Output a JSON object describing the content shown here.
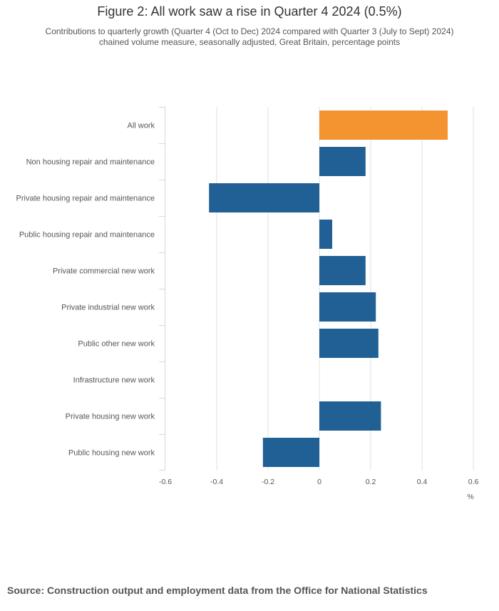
{
  "title": "Figure 2: All work saw a rise in Quarter 4 2024 (0.5%)",
  "subtitle_lines": [
    "Contributions to quarterly growth (Quarter 4 (Oct to Dec) 2024 compared with Quarter 3 (July to Sept) 2024)",
    "chained volume measure, seasonally adjusted, Great Britain, percentage points"
  ],
  "source": "Source: Construction output and employment data from the Office for National Statistics",
  "colors": {
    "highlight": "#f39431",
    "default": "#206095",
    "grid": "#e0e0e0",
    "axis": "#d0d8e4"
  },
  "chart_data": {
    "type": "bar",
    "orientation": "horizontal",
    "title": "Figure 2: All work saw a rise in Quarter 4 2024 (0.5%)",
    "xlabel": "%",
    "ylabel": "",
    "categories": [
      "All work",
      "Non housing repair and maintenance",
      "Private housing repair and maintenance",
      "Public housing repair and maintenance",
      "Private commercial new work",
      "Private industrial new work",
      "Public other new work",
      "Infrastructure new work",
      "Private housing new work",
      "Public housing new work"
    ],
    "values": [
      0.5,
      0.18,
      -0.43,
      0.05,
      0.18,
      0.22,
      0.23,
      0.0,
      0.24,
      -0.22
    ],
    "highlighted_categories": [
      "All work"
    ],
    "xlim": [
      -0.6,
      0.6
    ],
    "xticks": [
      -0.6,
      -0.4,
      -0.2,
      0,
      0.2,
      0.4,
      0.6
    ],
    "xtick_labels": [
      "-0.6",
      "-0.4",
      "-0.2",
      "0",
      "0.2",
      "0.4",
      "0.6"
    ],
    "grid": true,
    "legend": "none"
  }
}
